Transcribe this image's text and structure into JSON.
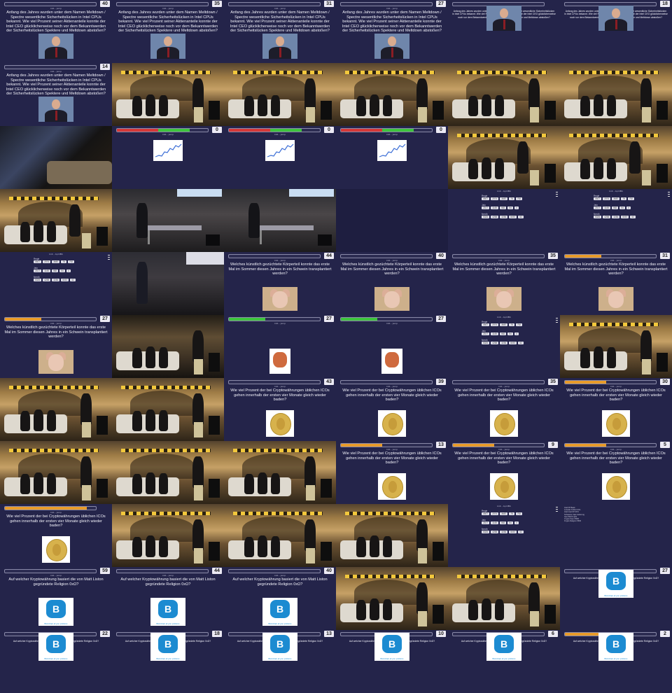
{
  "quiz_url": "tmb - jump",
  "result_url": "tmb - AprilBb",
  "questions": {
    "meltdown": "Anfang des Jahres wurden unter dem Namen Meltdown / Spectre wesentliche Sicherheitslücken in Intel CPUs bekannt. Wie viel Prozent seiner Aktienanteile konnte der Intel CEO glücklicherweise noch vor dem Bekanntwerden der Sicherheitslücken Spektere und Meltdown abstoßen?",
    "pig": "Welches künstlich gezüchtete Körperteil konnte das erste Mal im Sommer diesen Jahres in ein Schwein transplantiert werden?",
    "crypto_ico": "Wie viel Prozent der bei Cryptowährungen üblichen ICOs gehen innerhalb der ersten vier Monate gleich wieder baden?",
    "liston": "Auf welcher Kryptowährung basiert die von Matt Liston gegründete Religion 0xΩ?"
  },
  "logo_caption": "Blockchain all your problems",
  "result_labels": [
    "Regie",
    "Jalo",
    "Nerdh"
  ],
  "result_values": [
    [
      "4927",
      "2074",
      "3687",
      "78",
      "792"
    ],
    [
      "2107",
      "1145",
      "582",
      "54",
      "4"
    ],
    [
      "5326",
      "4258",
      "3284",
      "5057",
      "52"
    ]
  ],
  "results_text_lines": [
    "Intel FP Bank",
    "Lowcalc Kuhle ICOs",
    "Intel Intel FP CPU",
    "Schweine Cast Lieferung",
    "GemTECK Qbit",
    "Crypto Kaun 5500",
    "Krypto Religion 5500"
  ],
  "colors": {
    "background": "#1e1e40",
    "bar_red": "#d63838",
    "bar_green": "#3ec43e",
    "bar_orange": "#e89b2a",
    "bar_blue": "#3f7fd9"
  },
  "tiles": [
    {
      "kind": "quiz",
      "q": "meltdown",
      "count": "40",
      "img": "portrait",
      "fill": 0,
      "color": "bar_blue"
    },
    {
      "kind": "quiz",
      "q": "meltdown",
      "count": "35",
      "img": "portrait",
      "fill": 0,
      "color": "bar_blue"
    },
    {
      "kind": "quiz",
      "q": "meltdown",
      "count": "31",
      "img": "portrait",
      "fill": 0,
      "color": "bar_blue"
    },
    {
      "kind": "quiz",
      "q": "meltdown",
      "count": "27",
      "img": "portrait",
      "fill": 0,
      "color": "bar_blue"
    },
    {
      "kind": "quiz",
      "q": "meltdown",
      "count": "",
      "img": "portrait-small",
      "small": true,
      "fill": 0,
      "color": "bar_blue"
    },
    {
      "kind": "quiz",
      "q": "meltdown",
      "count": "18",
      "img": "portrait-small",
      "small": true,
      "fill": 0,
      "color": "bar_blue"
    },
    {
      "kind": "quiz",
      "q": "meltdown",
      "count": "14",
      "img": "portrait",
      "fill": 0,
      "color": "bar_blue"
    },
    {
      "kind": "photo"
    },
    {
      "kind": "photo"
    },
    {
      "kind": "photo"
    },
    {
      "kind": "photo"
    },
    {
      "kind": "photo"
    },
    {
      "kind": "projector"
    },
    {
      "kind": "chart",
      "count": "0",
      "fill": 0.8,
      "color": "bar_red",
      "fill2": 0.35,
      "color2": "bar_green"
    },
    {
      "kind": "chart",
      "count": "0",
      "fill": 0.8,
      "color": "bar_red",
      "fill2": 0.35,
      "color2": "bar_green"
    },
    {
      "kind": "chart",
      "count": "0",
      "fill": 0.8,
      "color": "bar_red",
      "fill2": 0.35,
      "color2": "bar_green"
    },
    {
      "kind": "photo",
      "variant": "wide"
    },
    {
      "kind": "photo",
      "variant": "wide"
    },
    {
      "kind": "photo",
      "variant": "wide"
    },
    {
      "kind": "hall"
    },
    {
      "kind": "hall"
    },
    {
      "kind": "blank"
    },
    {
      "kind": "result"
    },
    {
      "kind": "result"
    },
    {
      "kind": "result"
    },
    {
      "kind": "hall2"
    },
    {
      "kind": "quiz",
      "q": "pig",
      "count": "44",
      "img": "pig",
      "fill": 0,
      "color": "bar_orange"
    },
    {
      "kind": "quiz",
      "q": "pig",
      "count": "40",
      "img": "pig",
      "fill": 0,
      "color": "bar_orange"
    },
    {
      "kind": "quiz",
      "q": "pig",
      "count": "35",
      "img": "pig",
      "fill": 0,
      "color": "bar_orange"
    },
    {
      "kind": "quiz",
      "q": "pig",
      "count": "31",
      "img": "pig",
      "fill": 0.4,
      "color": "bar_orange"
    },
    {
      "kind": "quiz",
      "q": "pig",
      "count": "27",
      "img": "pig",
      "fill": 0.4,
      "color": "bar_orange"
    },
    {
      "kind": "photo",
      "variant": "alt"
    },
    {
      "kind": "ugly",
      "count": "27",
      "fill": 0.4,
      "color": "bar_green"
    },
    {
      "kind": "ugly",
      "count": "27",
      "fill": 0.4,
      "color": "bar_green"
    },
    {
      "kind": "result"
    },
    {
      "kind": "photo"
    },
    {
      "kind": "photo"
    },
    {
      "kind": "photo"
    },
    {
      "kind": "quiz",
      "q": "crypto_ico",
      "count": "43",
      "img": "coin",
      "fill": 0,
      "color": "bar_orange"
    },
    {
      "kind": "quiz",
      "q": "crypto_ico",
      "count": "39",
      "img": "coin",
      "fill": 0,
      "color": "bar_orange"
    },
    {
      "kind": "quiz",
      "q": "crypto_ico",
      "count": "35",
      "img": "coin",
      "fill": 0,
      "color": "bar_orange"
    },
    {
      "kind": "quiz",
      "q": "crypto_ico",
      "count": "30",
      "img": "coin",
      "fill": 0.45,
      "color": "bar_orange"
    },
    {
      "kind": "photo"
    },
    {
      "kind": "photo"
    },
    {
      "kind": "photo"
    },
    {
      "kind": "quiz",
      "q": "crypto_ico",
      "count": "13",
      "img": "coin",
      "fill": 0.45,
      "color": "bar_orange"
    },
    {
      "kind": "quiz",
      "q": "crypto_ico",
      "count": "9",
      "img": "coin",
      "fill": 0.45,
      "color": "bar_orange"
    },
    {
      "kind": "quiz",
      "q": "crypto_ico",
      "count": "5",
      "img": "coin",
      "fill": 0.45,
      "color": "bar_orange"
    },
    {
      "kind": "quiz",
      "q": "crypto_ico",
      "count": "",
      "img": "coin",
      "fill": 0.9,
      "color": "bar_orange"
    },
    {
      "kind": "photo"
    },
    {
      "kind": "photo"
    },
    {
      "kind": "photo"
    },
    {
      "kind": "result"
    },
    {
      "kind": "results_text"
    },
    {
      "kind": "quiz",
      "q": "liston",
      "count": "59",
      "img": "logo",
      "fill": 0,
      "color": "bar_blue"
    },
    {
      "kind": "quiz",
      "q": "liston",
      "count": "44",
      "img": "logo",
      "fill": 0,
      "color": "bar_blue"
    },
    {
      "kind": "quiz",
      "q": "liston",
      "count": "40",
      "img": "logo",
      "fill": 0,
      "color": "bar_blue"
    },
    {
      "kind": "photo"
    },
    {
      "kind": "photo"
    },
    {
      "kind": "quiz",
      "q": "liston",
      "count": "27",
      "img": "logo-small",
      "small": true,
      "fill": 0,
      "color": "bar_blue"
    },
    {
      "kind": "quiz",
      "q": "liston",
      "count": "22",
      "img": "logo-small",
      "small": true,
      "fill": 0,
      "color": "bar_blue"
    },
    {
      "kind": "quiz",
      "q": "liston",
      "count": "18",
      "img": "logo-small",
      "small": true,
      "fill": 0,
      "color": "bar_blue"
    },
    {
      "kind": "quiz",
      "q": "liston",
      "count": "13",
      "img": "logo-small",
      "small": true,
      "fill": 0,
      "color": "bar_blue"
    },
    {
      "kind": "quiz",
      "q": "liston",
      "count": "10",
      "img": "logo-small",
      "small": true,
      "fill": 0,
      "color": "bar_blue"
    },
    {
      "kind": "quiz",
      "q": "liston",
      "count": "6",
      "img": "logo-small",
      "small": true,
      "fill": 0,
      "color": "bar_blue"
    },
    {
      "kind": "quiz",
      "q": "liston",
      "count": "2",
      "img": "logo-small",
      "small": true,
      "fill": 0.4,
      "color": "bar_orange"
    }
  ]
}
